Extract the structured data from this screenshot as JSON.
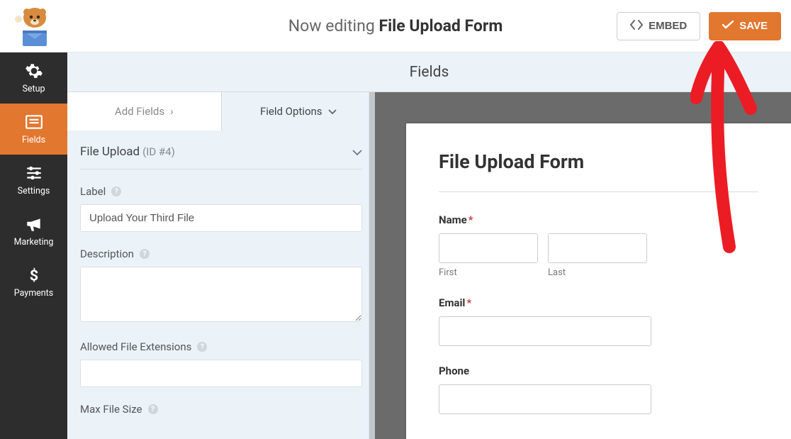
{
  "topbar": {
    "editing_prefix": "Now editing ",
    "form_name": "File Upload Form",
    "embed_label": "EMBED",
    "save_label": "SAVE"
  },
  "sidebar": {
    "items": [
      {
        "label": "Setup"
      },
      {
        "label": "Fields"
      },
      {
        "label": "Settings"
      },
      {
        "label": "Marketing"
      },
      {
        "label": "Payments"
      }
    ]
  },
  "panel": {
    "header": "Fields",
    "tabs": {
      "add": "Add Fields",
      "options": "Field Options"
    },
    "field_title": "File Upload",
    "field_id": "(ID #4)",
    "label_label": "Label",
    "label_value": "Upload Your Third File",
    "description_label": "Description",
    "description_value": "",
    "extensions_label": "Allowed File Extensions",
    "extensions_value": "",
    "maxsize_label": "Max File Size"
  },
  "preview": {
    "title": "File Upload Form",
    "name_label": "Name",
    "first_sub": "First",
    "last_sub": "Last",
    "email_label": "Email",
    "phone_label": "Phone",
    "required_mark": "*"
  }
}
